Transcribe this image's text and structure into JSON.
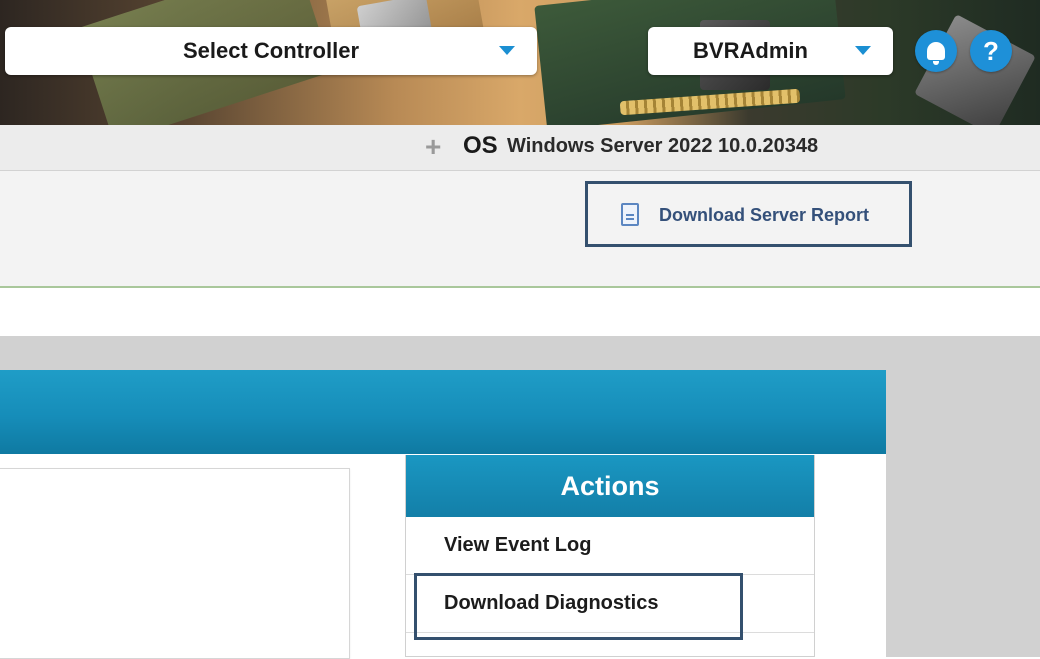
{
  "header": {
    "controller_select": {
      "value": "Select Controller",
      "icon": "chevron-down-icon"
    },
    "user_select": {
      "value": "BVRAdmin",
      "icon": "chevron-down-icon"
    },
    "notifications_icon": "bell-icon",
    "help_icon": {
      "glyph": "?",
      "icon": "help-icon"
    },
    "accent_color": "#1e90d8"
  },
  "os_bar": {
    "expand_glyph": "+",
    "label": "OS",
    "value": "Windows Server 2022 10.0.20348"
  },
  "report": {
    "icon": "document-icon",
    "label": "Download Server Report"
  },
  "actions": {
    "title": "Actions",
    "items": [
      {
        "label": "View Event Log"
      },
      {
        "label": "Download Diagnostics"
      }
    ]
  },
  "colors": {
    "panel_header": "#168db9",
    "highlight_frame": "#34506e"
  }
}
